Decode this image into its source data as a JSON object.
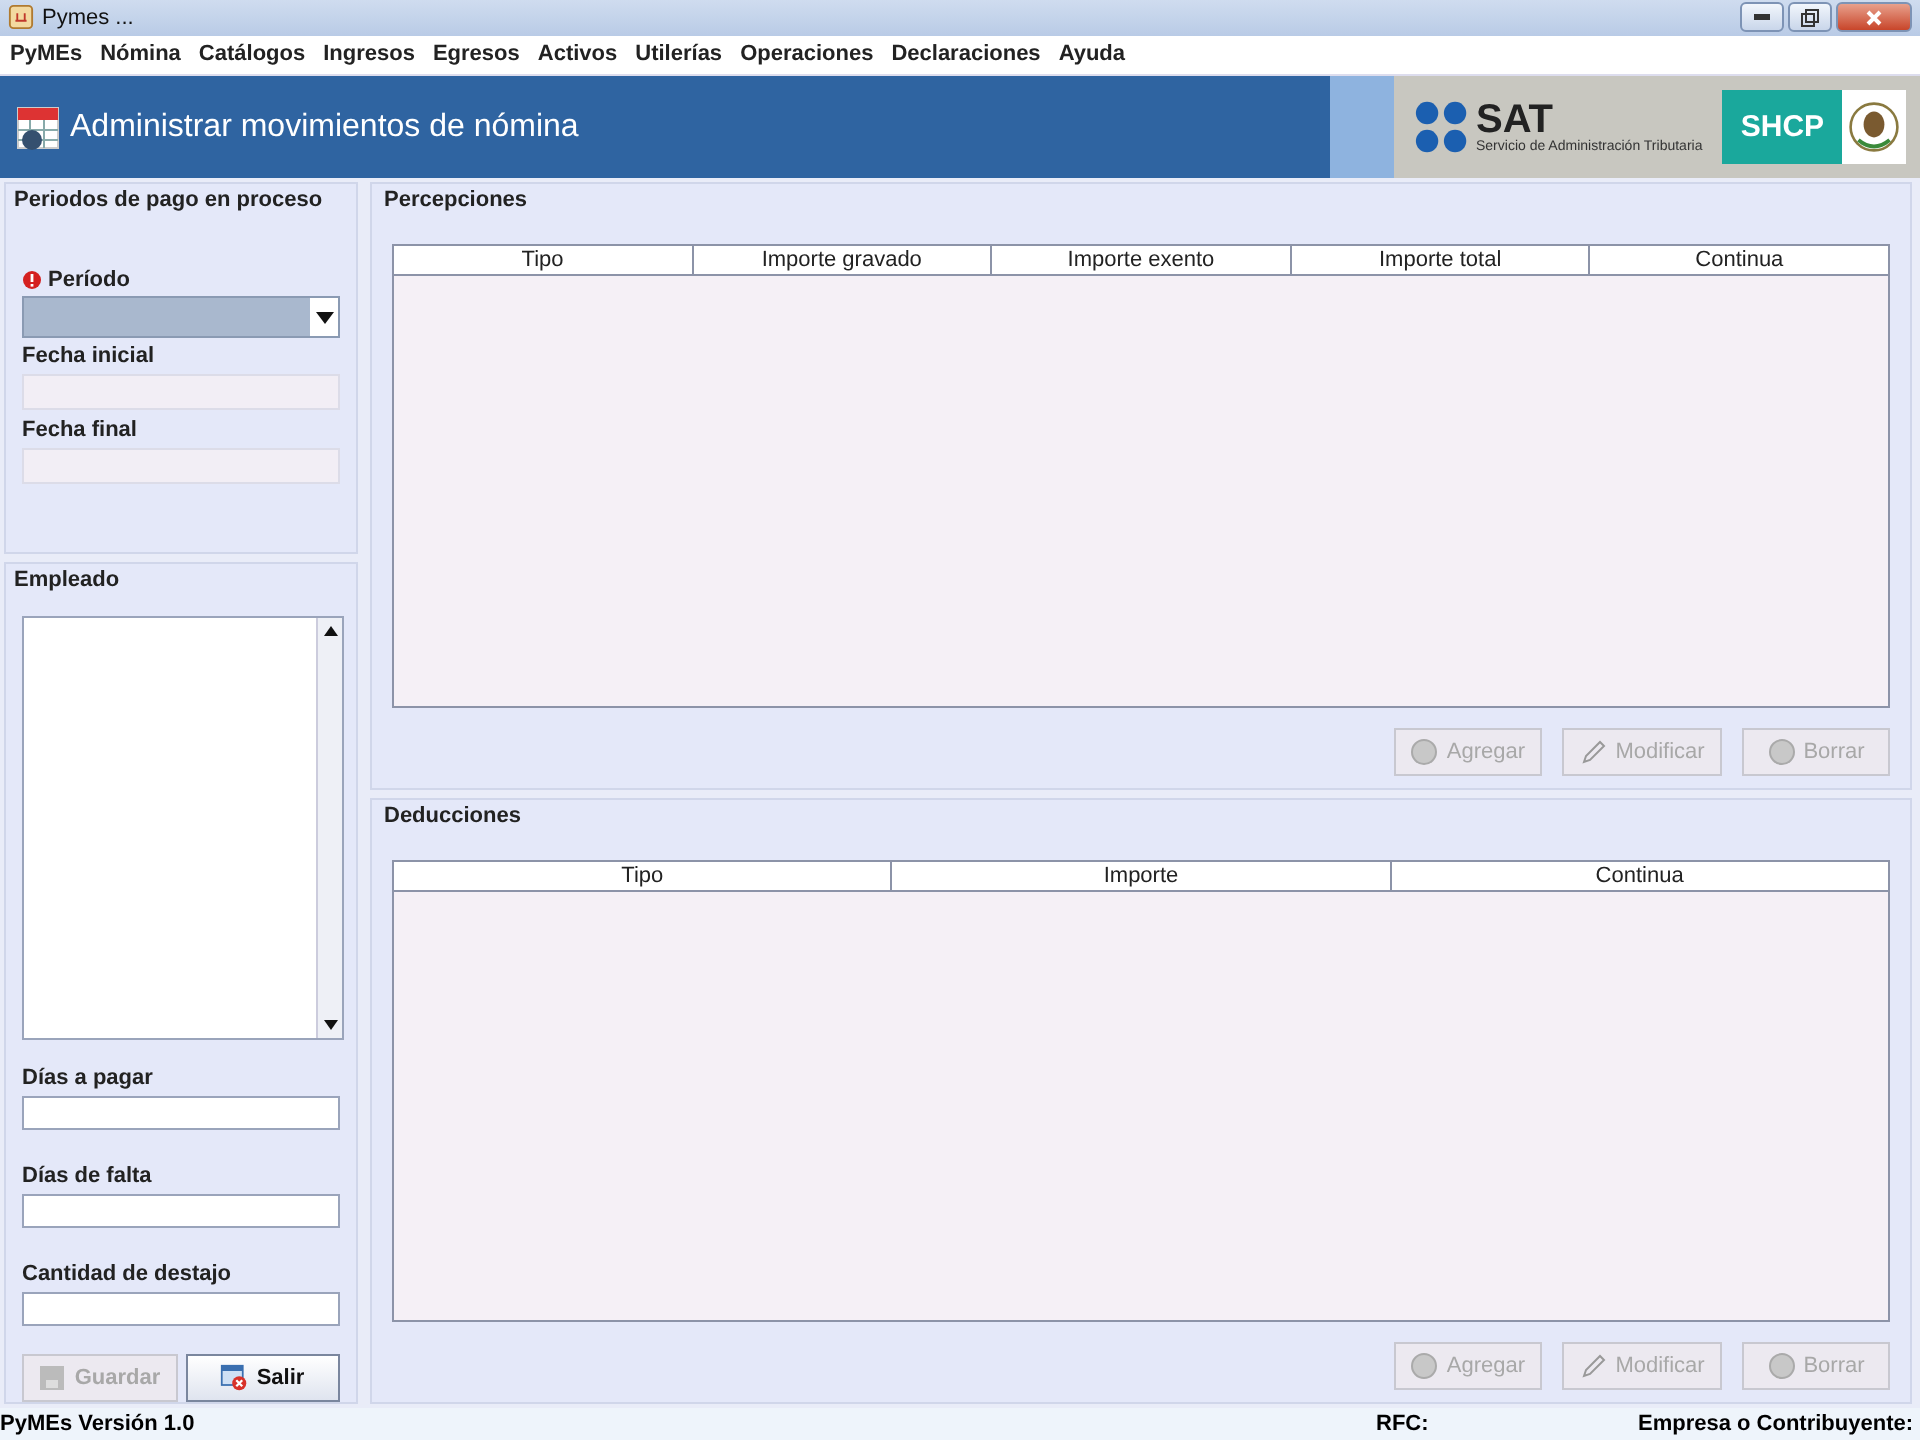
{
  "window": {
    "title": "Pymes ..."
  },
  "menu": [
    "PyMEs",
    "Nómina",
    "Catálogos",
    "Ingresos",
    "Egresos",
    "Activos",
    "Utilerías",
    "Operaciones",
    "Declaraciones",
    "Ayuda"
  ],
  "banner": {
    "title": "Administrar movimientos de nómina",
    "sat": "SAT",
    "sat_caption": "Servicio de Administración Tributaria",
    "shcp": "SHCP"
  },
  "periods": {
    "title": "Periodos de pago en proceso",
    "period_label": "Período",
    "period_required": true,
    "start_label": "Fecha inicial",
    "end_label": "Fecha final"
  },
  "employee": {
    "title": "Empleado"
  },
  "fields": [
    {
      "label": "Días a pagar"
    },
    {
      "label": "Días de falta"
    },
    {
      "label": "Cantidad de destajo"
    }
  ],
  "left_buttons": [
    {
      "label": "Guardar",
      "kind": "save",
      "disabled": true
    },
    {
      "label": "Salir",
      "kind": "exit",
      "disabled": false
    }
  ],
  "sections": [
    {
      "title": "Percepciones",
      "columns": [
        "Tipo",
        "Importe gravado",
        "Importe exento",
        "Importe total",
        "Continua"
      ],
      "buttons": [
        {
          "label": "Agregar",
          "kind": "add",
          "disabled": true
        },
        {
          "label": "Modificar",
          "kind": "edit",
          "disabled": true
        },
        {
          "label": "Borrar",
          "kind": "delete",
          "disabled": true
        }
      ]
    },
    {
      "title": "Deducciones",
      "columns": [
        "Tipo",
        "Importe",
        "Continua"
      ],
      "buttons": [
        {
          "label": "Agregar",
          "kind": "add",
          "disabled": true
        },
        {
          "label": "Modificar",
          "kind": "edit",
          "disabled": true
        },
        {
          "label": "Borrar",
          "kind": "delete",
          "disabled": true
        }
      ]
    }
  ],
  "status_bar": {
    "version": "PyMEs Versión 1.0",
    "rfc": "RFC:",
    "company": "Empresa o Contribuyente:"
  }
}
